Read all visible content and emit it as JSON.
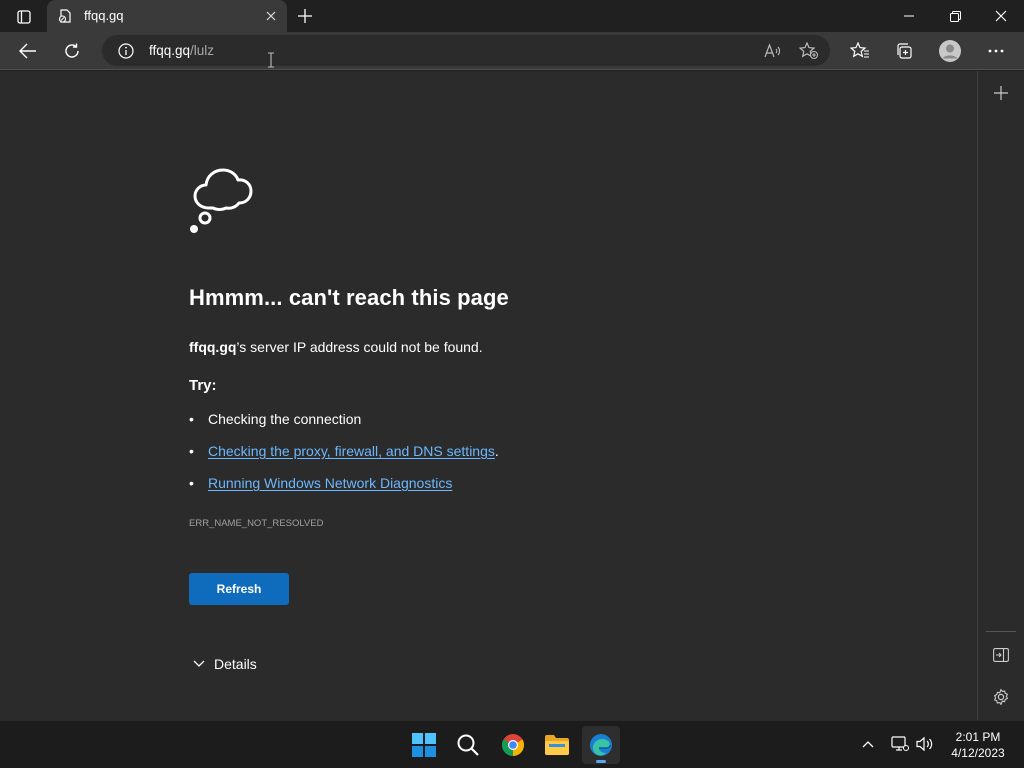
{
  "tab": {
    "title": "ffqq.gq"
  },
  "address_bar": {
    "host": "ffqq.gq",
    "path": "/lulz"
  },
  "error_page": {
    "heading": "Hmmm... can't reach this page",
    "server_host": "ffqq.gq",
    "server_message": "’s server IP address could not be found.",
    "try_label": "Try:",
    "bullet": "•",
    "suggestion_1": "Checking the connection",
    "suggestion_2_link": "Checking the proxy, firewall, and DNS settings",
    "suggestion_2_suffix": ".",
    "suggestion_3_link": "Running Windows Network Diagnostics",
    "error_code": "ERR_NAME_NOT_RESOLVED",
    "refresh_label": "Refresh",
    "details_label": "Details"
  },
  "taskbar": {
    "time": "2:01 PM",
    "date": "4/12/2023"
  },
  "colors": {
    "accent": "#0f6cbd",
    "link": "#6cb8ff",
    "page_bg": "#2b2b2b",
    "chrome_bg": "#202020"
  }
}
